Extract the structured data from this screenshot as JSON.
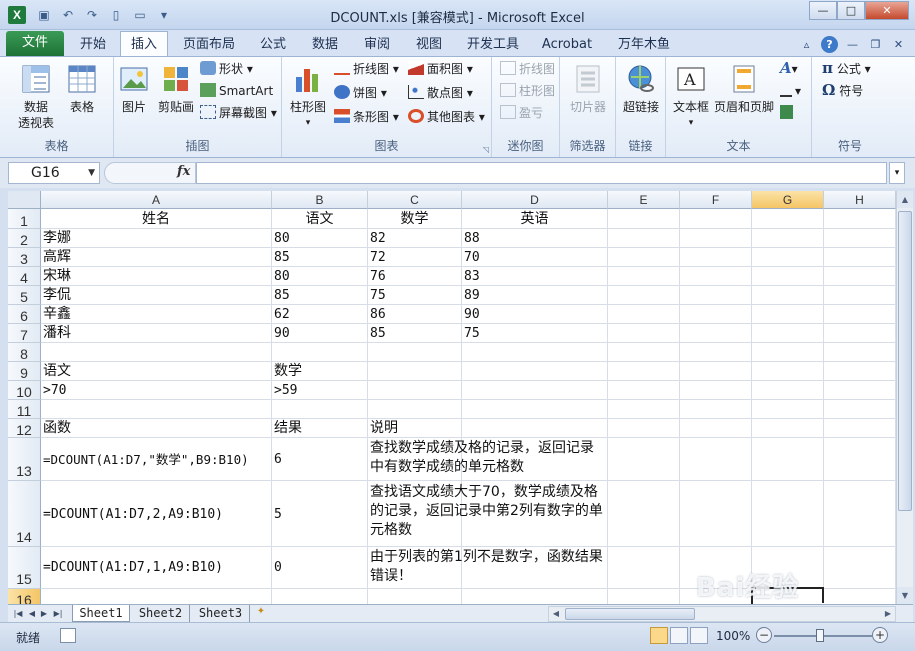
{
  "window": {
    "title": "DCOUNT.xls  [兼容模式] - Microsoft Excel",
    "app_icon": "X"
  },
  "quick_access": [
    "save-icon",
    "undo-icon",
    "redo-icon",
    "new-icon",
    "open-icon",
    "customize-icon"
  ],
  "ribbon_tabs": {
    "file": "文件",
    "tabs": [
      "开始",
      "插入",
      "页面布局",
      "公式",
      "数据",
      "审阅",
      "视图",
      "开发工具",
      "Acrobat",
      "万年木鱼"
    ],
    "active": "插入"
  },
  "ribbon": {
    "groups": {
      "tables": {
        "label": "表格",
        "pivot": "数据\n透视表",
        "table": "表格"
      },
      "illustrations": {
        "label": "插图",
        "picture": "图片",
        "clipart": "剪贴画",
        "shapes": "形状",
        "smartart": "SmartArt",
        "screenshot": "屏幕截图"
      },
      "charts": {
        "label": "图表",
        "column": "柱形图",
        "line": "折线图",
        "pie": "饼图",
        "bar": "条形图",
        "area": "面积图",
        "scatter": "散点图",
        "other": "其他图表"
      },
      "sparklines": {
        "label": "迷你图",
        "line": "折线图",
        "column": "柱形图",
        "winloss": "盈亏"
      },
      "filter": {
        "label": "筛选器",
        "slicer": "切片器"
      },
      "links": {
        "label": "链接",
        "hyperlink": "超链接"
      },
      "text": {
        "label": "文本",
        "textbox": "文本框",
        "headerfooter": "页眉和页脚"
      },
      "symbols": {
        "label": "符号",
        "equation": "公式",
        "symbol": "符号"
      }
    }
  },
  "formula_bar": {
    "name_box": "G16",
    "fx": "fx",
    "formula": ""
  },
  "columns": [
    "A",
    "B",
    "C",
    "D",
    "E",
    "F",
    "G",
    "H"
  ],
  "selected_column": "G",
  "rows": [
    "1",
    "2",
    "3",
    "4",
    "5",
    "6",
    "7",
    "8",
    "9",
    "10",
    "11",
    "12",
    "13",
    "14",
    "15",
    "16"
  ],
  "selected_row": "16",
  "cells": {
    "header": [
      "姓名",
      "语文",
      "数学",
      "英语"
    ],
    "students": [
      [
        "李娜",
        "80",
        "82",
        "88"
      ],
      [
        "高辉",
        "85",
        "72",
        "70"
      ],
      [
        "宋琳",
        "80",
        "76",
        "83"
      ],
      [
        "李侃",
        "85",
        "75",
        "89"
      ],
      [
        "辛鑫",
        "62",
        "86",
        "90"
      ],
      [
        "潘科",
        "90",
        "85",
        "75"
      ]
    ],
    "criteria_header": [
      "语文",
      "数学"
    ],
    "criteria_values": [
      ">70",
      ">59"
    ],
    "func_header": [
      "函数",
      "结果",
      "说明"
    ],
    "functions": [
      {
        "formula": "=DCOUNT(A1:D7,\"数学\",B9:B10)",
        "result": "6",
        "note": "查找数学成绩及格的记录，返回记录中有数学成绩的单元格数"
      },
      {
        "formula": "=DCOUNT(A1:D7,2,A9:B10)",
        "result": "5",
        "note": "查找语文成绩大于70，数学成绩及格的记录，返回记录中第2列有数字的单元格数"
      },
      {
        "formula": "=DCOUNT(A1:D7,1,A9:B10)",
        "result": "0",
        "note": "由于列表的第1列不是数字，函数结果错误！"
      }
    ]
  },
  "sheet_tabs": [
    "Sheet1",
    "Sheet2",
    "Sheet3"
  ],
  "active_sheet": "Sheet1",
  "status": {
    "ready": "就绪",
    "zoom": "100%"
  },
  "watermark": "Bai经验"
}
